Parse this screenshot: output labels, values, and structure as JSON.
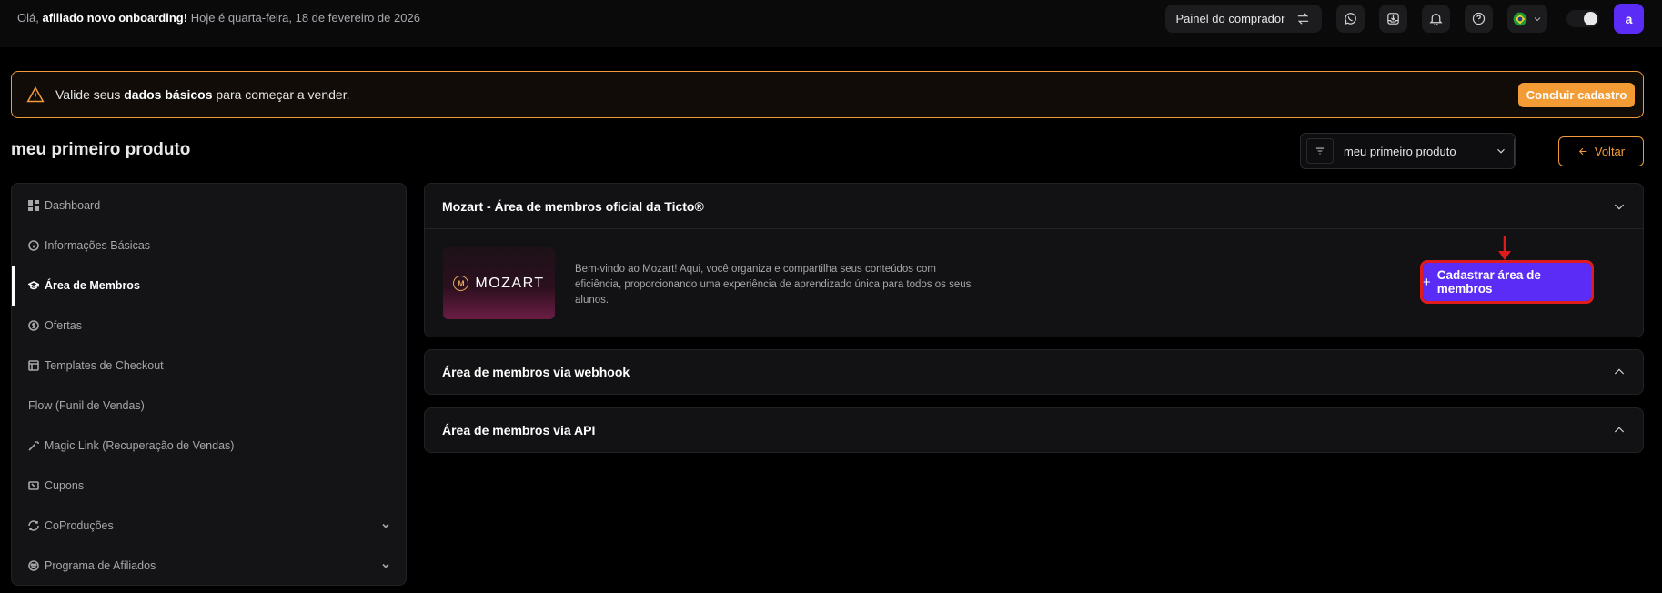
{
  "header": {
    "greeting_prefix": "Olá,",
    "greeting_name": "afiliado novo onboarding!",
    "greeting_date": "Hoje é quarta-feira, 18 de fevereiro de 2026",
    "buyer_panel_label": "Painel do comprador",
    "avatar_letter": "a"
  },
  "alert": {
    "text_prefix": "Valide seus",
    "text_bold": "dados básicos",
    "text_suffix": "para começar a vender.",
    "button_label": "Concluir cadastro"
  },
  "page": {
    "title": "meu primeiro produto",
    "product_select_value": "meu primeiro produto",
    "back_label": "Voltar"
  },
  "sidebar": {
    "items": [
      {
        "label": "Dashboard",
        "icon": "dashboard-icon"
      },
      {
        "label": "Informações Básicas",
        "icon": "info-icon"
      },
      {
        "label": "Área de Membros",
        "icon": "graduation-cap-icon",
        "active": true
      },
      {
        "label": "Ofertas",
        "icon": "dollar-icon"
      },
      {
        "label": "Templates de Checkout",
        "icon": "template-icon"
      },
      {
        "label": "Flow (Funil de Vendas)",
        "icon": "flow-icon"
      },
      {
        "label": "Magic Link (Recuperação de Vendas)",
        "icon": "magic-wand-icon"
      },
      {
        "label": "Cupons",
        "icon": "coupon-icon"
      },
      {
        "label": "CoProduções",
        "icon": "coproduction-icon",
        "expandable": true
      },
      {
        "label": "Programa de Afiliados",
        "icon": "affiliates-icon",
        "expandable": true
      }
    ]
  },
  "main": {
    "mozart_panel": {
      "title": "Mozart - Área de membros oficial da Ticto®",
      "logo_text": "MOZART",
      "logo_mark": "M",
      "description": "Bem-vindo ao Mozart! Aqui, você organiza e compartilha seus conteúdos com eficiência, proporcionando uma experiência de aprendizado única para todos os seus alunos.",
      "register_button_label": "Cadastrar área de membros"
    },
    "webhook_panel": {
      "title": "Área de membros via webhook"
    },
    "api_panel": {
      "title": "Área de membros via API"
    }
  },
  "colors": {
    "accent_orange": "#f29a3c",
    "primary_purple": "#5b2cf6",
    "highlight_red": "#e01b1b"
  }
}
